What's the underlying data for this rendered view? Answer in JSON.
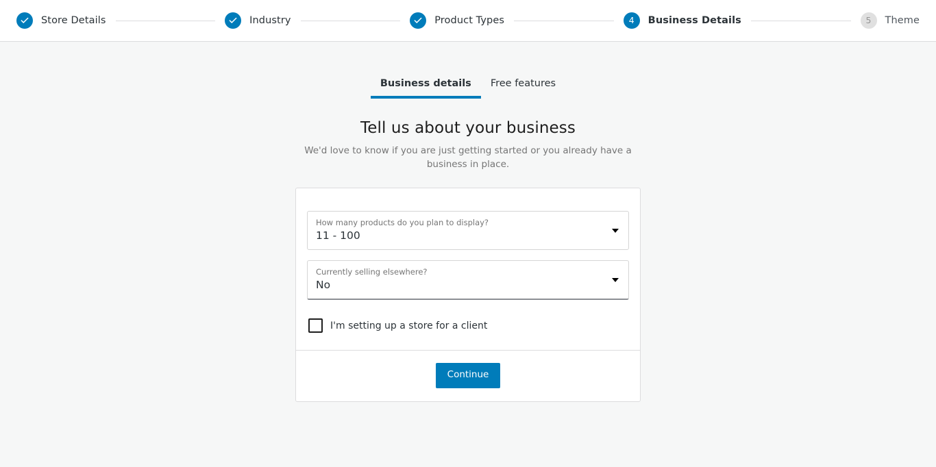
{
  "colors": {
    "accent": "#007cba",
    "page_background": "#f6f7f7",
    "card_background": "#ffffff",
    "border": "#dcdcde",
    "muted_text": "#757575",
    "upcoming_step": "#e0e0e0"
  },
  "stepper": {
    "steps": [
      {
        "label": "Store Details",
        "marker": "check",
        "state": "done"
      },
      {
        "label": "Industry",
        "marker": "check",
        "state": "done"
      },
      {
        "label": "Product Types",
        "marker": "check",
        "state": "done"
      },
      {
        "label": "Business Details",
        "marker": "4",
        "state": "current"
      },
      {
        "label": "Theme",
        "marker": "5",
        "state": "upcoming"
      }
    ]
  },
  "tabs": [
    {
      "label": "Business details",
      "active": true
    },
    {
      "label": "Free features",
      "active": false
    }
  ],
  "heading": {
    "title": "Tell us about your business",
    "subtitle": "We'd love to know if you are just getting started or you already have a business in place."
  },
  "form": {
    "fields": [
      {
        "label": "How many products do you plan to display?",
        "value": "11 - 100",
        "focused": false
      },
      {
        "label": "Currently selling elsewhere?",
        "value": "No",
        "focused": true
      }
    ],
    "checkbox": {
      "label": "I'm setting up a store for a client",
      "checked": false
    },
    "submit_label": "Continue"
  }
}
